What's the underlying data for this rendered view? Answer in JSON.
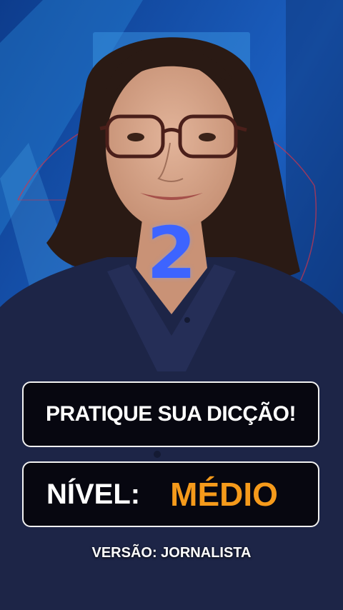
{
  "video": {
    "countdown": "2",
    "title": "PRATIQUE SUA DICÇÃO!",
    "level_label": "NÍVEL:",
    "level_value": "MÉDIO",
    "version": "VERSÃO: JORNALISTA"
  },
  "colors": {
    "level_accent": "#f59a1b",
    "countdown": "#3d64ff",
    "background": "#1b5fc0"
  }
}
